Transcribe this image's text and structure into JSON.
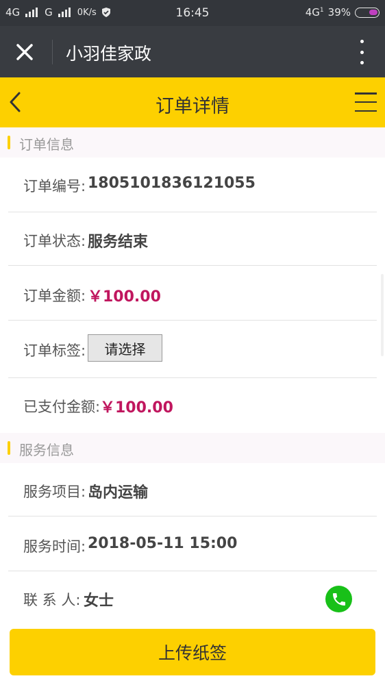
{
  "status_bar": {
    "net1": "4G",
    "net2": "G",
    "speed": "0K/s",
    "time": "16:45",
    "net3": "4G",
    "net3_sub": "1",
    "battery": "39%",
    "battery_level": 0.39
  },
  "app_bar": {
    "title": "小羽佳家政",
    "close_icon": "close-icon",
    "more_icon": "more-vertical-icon"
  },
  "page_header": {
    "title": "订单详情",
    "back_icon": "chevron-left-icon",
    "menu_icon": "hamburger-menu-icon"
  },
  "order_info": {
    "section_title": "订单信息",
    "order_no_label": "订单编号",
    "order_no": "1805101836121055",
    "status_label": "订单状态",
    "status": "服务结束",
    "amount_label": "订单金额",
    "amount": "￥100.00",
    "tag_label": "订单标签",
    "tag_select": "请选择",
    "paid_label": "已支付金额",
    "paid": "￥100.00"
  },
  "service_info": {
    "section_title": "服务信息",
    "item_label": "服务项目",
    "item": "岛内运输",
    "time_label": "服务时间",
    "time": "2018-05-11 15:00",
    "contact_label": "联 系 人",
    "contact": "女士",
    "phone_icon": "phone-icon"
  },
  "actions": {
    "upload_label": "上传纸签"
  },
  "colors": {
    "accent": "#fdd000",
    "money": "#c0165e",
    "phone": "#18c018",
    "dark_bar": "#393c41"
  }
}
